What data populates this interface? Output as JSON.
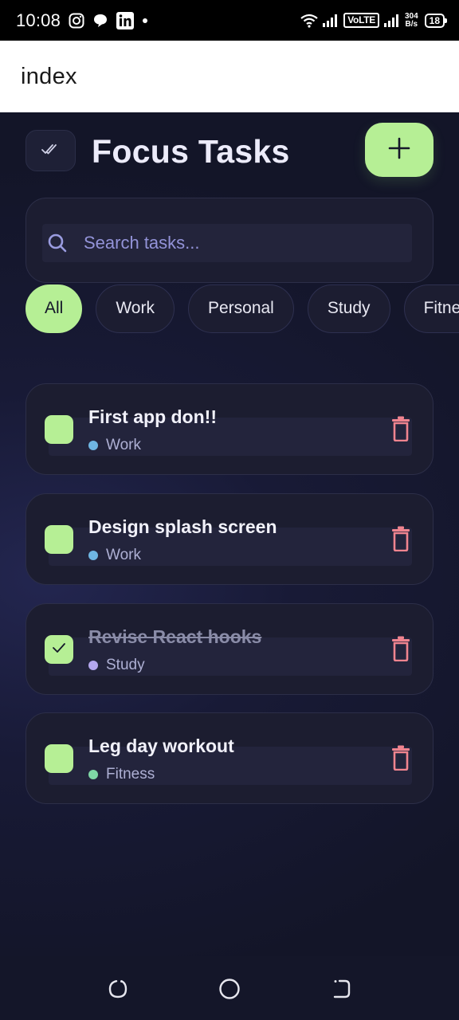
{
  "status_bar": {
    "time": "10:08",
    "left_icons": [
      "instagram-icon",
      "chat-icon",
      "linkedin-icon",
      "dot-icon"
    ],
    "volte": "VoLTE",
    "speed_value": "304",
    "speed_unit": "B/s",
    "battery": "18"
  },
  "header": {
    "title": "index"
  },
  "app": {
    "title": "Focus Tasks",
    "add_icon": "plus-icon",
    "check_all_icon": "double-check-icon",
    "accent_color": "#b6ef95",
    "delete_color": "#f0848f"
  },
  "search": {
    "placeholder": "Search tasks...",
    "value": ""
  },
  "filters": [
    {
      "label": "All",
      "active": true
    },
    {
      "label": "Work",
      "active": false
    },
    {
      "label": "Personal",
      "active": false
    },
    {
      "label": "Study",
      "active": false
    },
    {
      "label": "Fitness",
      "active": false
    }
  ],
  "tasks": [
    {
      "title": "First app don!!",
      "category": "Work",
      "category_color": "#6fb6e3",
      "done": false
    },
    {
      "title": "Design splash screen",
      "category": "Work",
      "category_color": "#6fb6e3",
      "done": false
    },
    {
      "title": "Revise React hooks",
      "category": "Study",
      "category_color": "#b4a7ee",
      "done": true
    },
    {
      "title": "Leg day workout",
      "category": "Fitness",
      "category_color": "#7fd8a6",
      "done": false
    }
  ],
  "nav_bar": [
    "recents-icon",
    "home-icon",
    "back-icon"
  ]
}
